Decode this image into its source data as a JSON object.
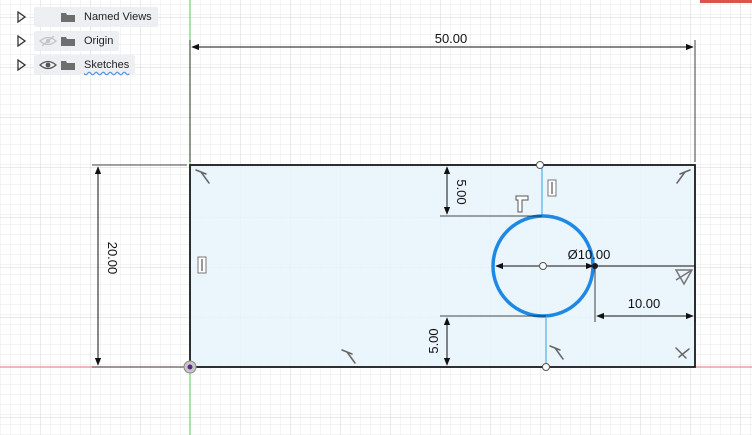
{
  "browser": {
    "items": [
      {
        "label": "Named Views",
        "visibility_icon": "none",
        "folder_icon": "folder-icon",
        "expand_icon": "expand-arrow-icon"
      },
      {
        "label": "Origin",
        "visibility_icon": "eye-hidden-icon",
        "folder_icon": "folder-icon",
        "expand_icon": "expand-arrow-icon"
      },
      {
        "label": "Sketches",
        "visibility_icon": "eye-icon",
        "folder_icon": "folder-icon",
        "expand_icon": "expand-arrow-icon"
      }
    ]
  },
  "sketch": {
    "dimensions": {
      "width": "50.00",
      "height": "20.00",
      "hole_diameter": "Ø10.00",
      "hole_from_right": "10.00",
      "hole_from_top": "5.00",
      "hole_from_bottom": "5.00"
    },
    "colors": {
      "profile_fill": "#e8f3fb",
      "circle": "#1e88e5",
      "construction_line": "#6fbfe8",
      "grid_minor": "#e6e6e6",
      "grid_major": "#d0d0d0",
      "x_axis": "#e07070",
      "y_axis": "#58c458",
      "geometry": "#1a1a1a"
    }
  }
}
